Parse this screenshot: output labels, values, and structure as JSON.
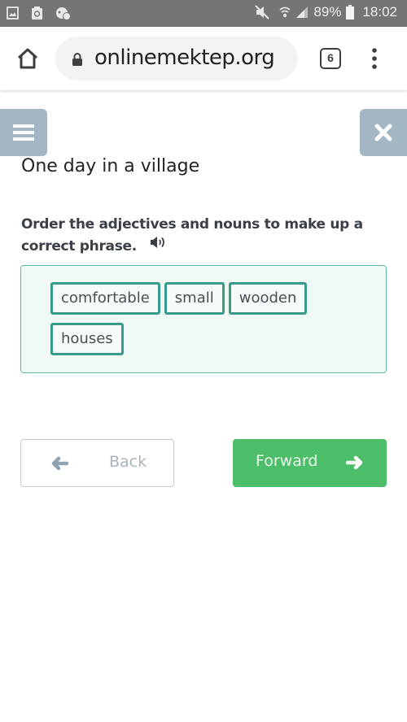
{
  "status_bar": {
    "left_icons": [
      "gallery-icon",
      "recycle-clipboard-icon",
      "chat-bubble-icon"
    ],
    "right_icons": [
      "mute-icon",
      "wifi-icon",
      "signal-icon",
      "battery-icon"
    ],
    "battery_percent": "89%",
    "time": "18:02"
  },
  "browser": {
    "url": "onlinemektep.org",
    "tab_count": "6",
    "icons": [
      "home-icon",
      "lock-icon",
      "tabs-icon",
      "more-vert-icon"
    ]
  },
  "page": {
    "title": "One day in a village",
    "instruction": "Order the adjectives and nouns to make up a correct phrase.",
    "words": [
      "comfortable",
      "small",
      "wooden",
      "houses"
    ],
    "nav": {
      "back_label": "Back",
      "forward_label": "Forward"
    },
    "colors": {
      "accent_green": "#4cbe6a",
      "chip_border": "#3a9a89",
      "side_button": "#a3b6c4"
    }
  }
}
